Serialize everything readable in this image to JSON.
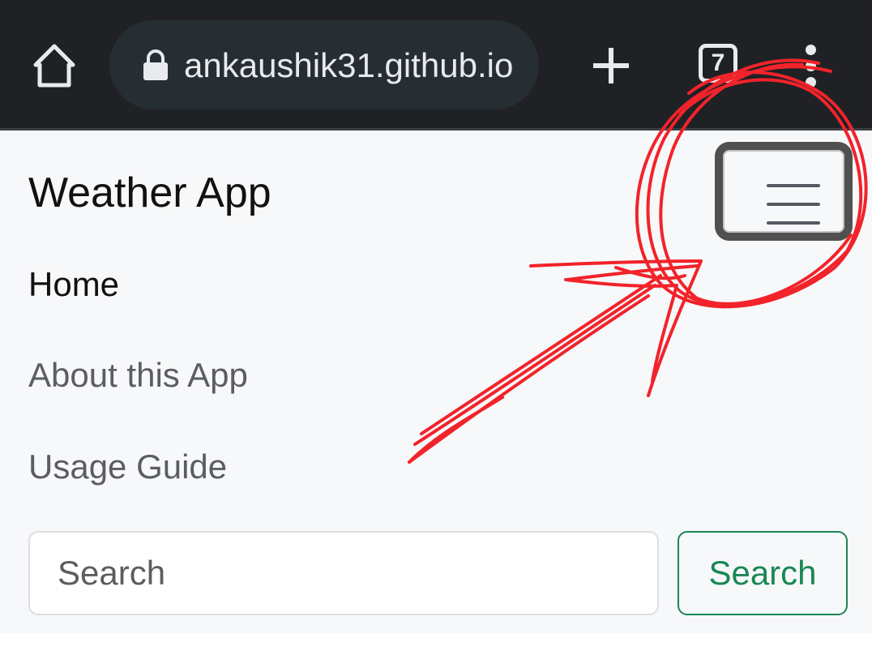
{
  "browser": {
    "url": "ankaushik31.github.io",
    "tab_count": "7",
    "icons": {
      "home": "home-icon",
      "lock": "lock-icon",
      "new_tab": "plus-icon",
      "tabs": "tab-switcher-icon",
      "menu": "more-vert-icon"
    }
  },
  "navbar": {
    "brand": "Weather App",
    "toggler_icon": "hamburger-menu-icon",
    "links": [
      {
        "label": "Home",
        "active": true
      },
      {
        "label": "About this App",
        "active": false
      },
      {
        "label": "Usage Guide",
        "active": false
      }
    ],
    "search": {
      "placeholder": "Search",
      "value": "",
      "button_label": "Search"
    }
  },
  "colors": {
    "browser_bar": "#1f2124",
    "url_pill": "#262e33",
    "navbar_bg": "#f7f8fa",
    "search_accent": "#198754",
    "annotation": "#f2232a",
    "toggler_highlight": "#505050"
  }
}
